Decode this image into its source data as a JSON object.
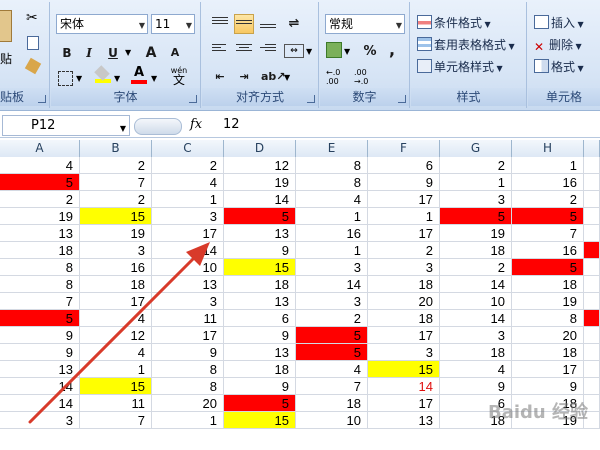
{
  "ribbon": {
    "clipboard": {
      "paste_label": "贴",
      "group_label": "贴板"
    },
    "font": {
      "font_name": "宋体",
      "font_size": "11",
      "bold": "B",
      "italic": "I",
      "underline": "U",
      "grow": "A",
      "shrink": "A",
      "font_color_letter": "A",
      "wen": "wén",
      "group_label": "字体"
    },
    "alignment": {
      "group_label": "对齐方式"
    },
    "number": {
      "format": "常规",
      "percent": "%",
      "comma": ",",
      "inc_dec": ".00",
      "dec_dec": ".00",
      "group_label": "数字"
    },
    "styles": {
      "conditional": "条件格式",
      "table": "套用表格格式",
      "cell_style": "单元格样式",
      "group_label": "样式"
    },
    "cells": {
      "insert": "插入",
      "delete": "删除",
      "format": "格式",
      "group_label": "单元格"
    }
  },
  "formula_bar": {
    "cell_ref": "P12",
    "fx": "fx",
    "value": "12"
  },
  "columns": [
    "A",
    "B",
    "C",
    "D",
    "E",
    "F",
    "G",
    "H"
  ],
  "rows": [
    [
      {
        "v": "4"
      },
      {
        "v": "2"
      },
      {
        "v": "2"
      },
      {
        "v": "12"
      },
      {
        "v": "8"
      },
      {
        "v": "6"
      },
      {
        "v": "2"
      },
      {
        "v": "1"
      }
    ],
    [
      {
        "v": "5",
        "f": "red"
      },
      {
        "v": "7"
      },
      {
        "v": "4"
      },
      {
        "v": "19"
      },
      {
        "v": "8"
      },
      {
        "v": "9"
      },
      {
        "v": "1"
      },
      {
        "v": "16"
      }
    ],
    [
      {
        "v": "2"
      },
      {
        "v": "2"
      },
      {
        "v": "1"
      },
      {
        "v": "14"
      },
      {
        "v": "4"
      },
      {
        "v": "17"
      },
      {
        "v": "3"
      },
      {
        "v": "2"
      }
    ],
    [
      {
        "v": "19"
      },
      {
        "v": "15",
        "f": "yel"
      },
      {
        "v": "3"
      },
      {
        "v": "5",
        "f": "red"
      },
      {
        "v": "1"
      },
      {
        "v": "1"
      },
      {
        "v": "5",
        "f": "red"
      },
      {
        "v": "5",
        "f": "red"
      }
    ],
    [
      {
        "v": "13"
      },
      {
        "v": "19"
      },
      {
        "v": "17"
      },
      {
        "v": "13"
      },
      {
        "v": "16"
      },
      {
        "v": "17"
      },
      {
        "v": "19"
      },
      {
        "v": "7"
      }
    ],
    [
      {
        "v": "18"
      },
      {
        "v": "3"
      },
      {
        "v": "14"
      },
      {
        "v": "9"
      },
      {
        "v": "1"
      },
      {
        "v": "2"
      },
      {
        "v": "18"
      },
      {
        "v": "16"
      }
    ],
    [
      {
        "v": "8"
      },
      {
        "v": "16"
      },
      {
        "v": "10"
      },
      {
        "v": "15",
        "f": "yel"
      },
      {
        "v": "3"
      },
      {
        "v": "3"
      },
      {
        "v": "2"
      },
      {
        "v": "5",
        "f": "red"
      }
    ],
    [
      {
        "v": "8"
      },
      {
        "v": "18"
      },
      {
        "v": "13"
      },
      {
        "v": "18"
      },
      {
        "v": "14"
      },
      {
        "v": "18"
      },
      {
        "v": "14"
      },
      {
        "v": "18"
      }
    ],
    [
      {
        "v": "7"
      },
      {
        "v": "17"
      },
      {
        "v": "3"
      },
      {
        "v": "13"
      },
      {
        "v": "3"
      },
      {
        "v": "20"
      },
      {
        "v": "10"
      },
      {
        "v": "19"
      }
    ],
    [
      {
        "v": "5",
        "f": "red"
      },
      {
        "v": "4"
      },
      {
        "v": "11"
      },
      {
        "v": "6"
      },
      {
        "v": "2"
      },
      {
        "v": "18"
      },
      {
        "v": "14"
      },
      {
        "v": "8"
      }
    ],
    [
      {
        "v": "9"
      },
      {
        "v": "12"
      },
      {
        "v": "17"
      },
      {
        "v": "9"
      },
      {
        "v": "5",
        "f": "red"
      },
      {
        "v": "17"
      },
      {
        "v": "3"
      },
      {
        "v": "20"
      }
    ],
    [
      {
        "v": "9"
      },
      {
        "v": "4"
      },
      {
        "v": "9"
      },
      {
        "v": "13"
      },
      {
        "v": "5",
        "f": "red"
      },
      {
        "v": "3"
      },
      {
        "v": "18"
      },
      {
        "v": "18"
      }
    ],
    [
      {
        "v": "13"
      },
      {
        "v": "1"
      },
      {
        "v": "8"
      },
      {
        "v": "18"
      },
      {
        "v": "4"
      },
      {
        "v": "15",
        "f": "yel"
      },
      {
        "v": "4"
      },
      {
        "v": "17"
      }
    ],
    [
      {
        "v": "14"
      },
      {
        "v": "15",
        "f": "yel"
      },
      {
        "v": "8"
      },
      {
        "v": "9"
      },
      {
        "v": "7"
      },
      {
        "v": "14",
        "t": "red"
      },
      {
        "v": "9"
      },
      {
        "v": "9"
      }
    ],
    [
      {
        "v": "14"
      },
      {
        "v": "11"
      },
      {
        "v": "20"
      },
      {
        "v": "5",
        "f": "red"
      },
      {
        "v": "18"
      },
      {
        "v": "17"
      },
      {
        "v": "6"
      },
      {
        "v": "18"
      }
    ],
    [
      {
        "v": "3"
      },
      {
        "v": "7"
      },
      {
        "v": "1"
      },
      {
        "v": "15",
        "f": "yel"
      },
      {
        "v": "10"
      },
      {
        "v": "13"
      },
      {
        "v": "18"
      },
      {
        "v": "19"
      }
    ]
  ],
  "right_edge_fills": [
    "",
    "",
    "",
    "",
    "",
    "red",
    "",
    "",
    "",
    "red",
    "",
    "",
    "",
    "",
    "",
    ""
  ],
  "watermark": "Baidu 经验",
  "colors": {
    "highlight_red": "#ff0000",
    "highlight_yellow": "#ffff00",
    "arrow": "#d83a2a"
  }
}
